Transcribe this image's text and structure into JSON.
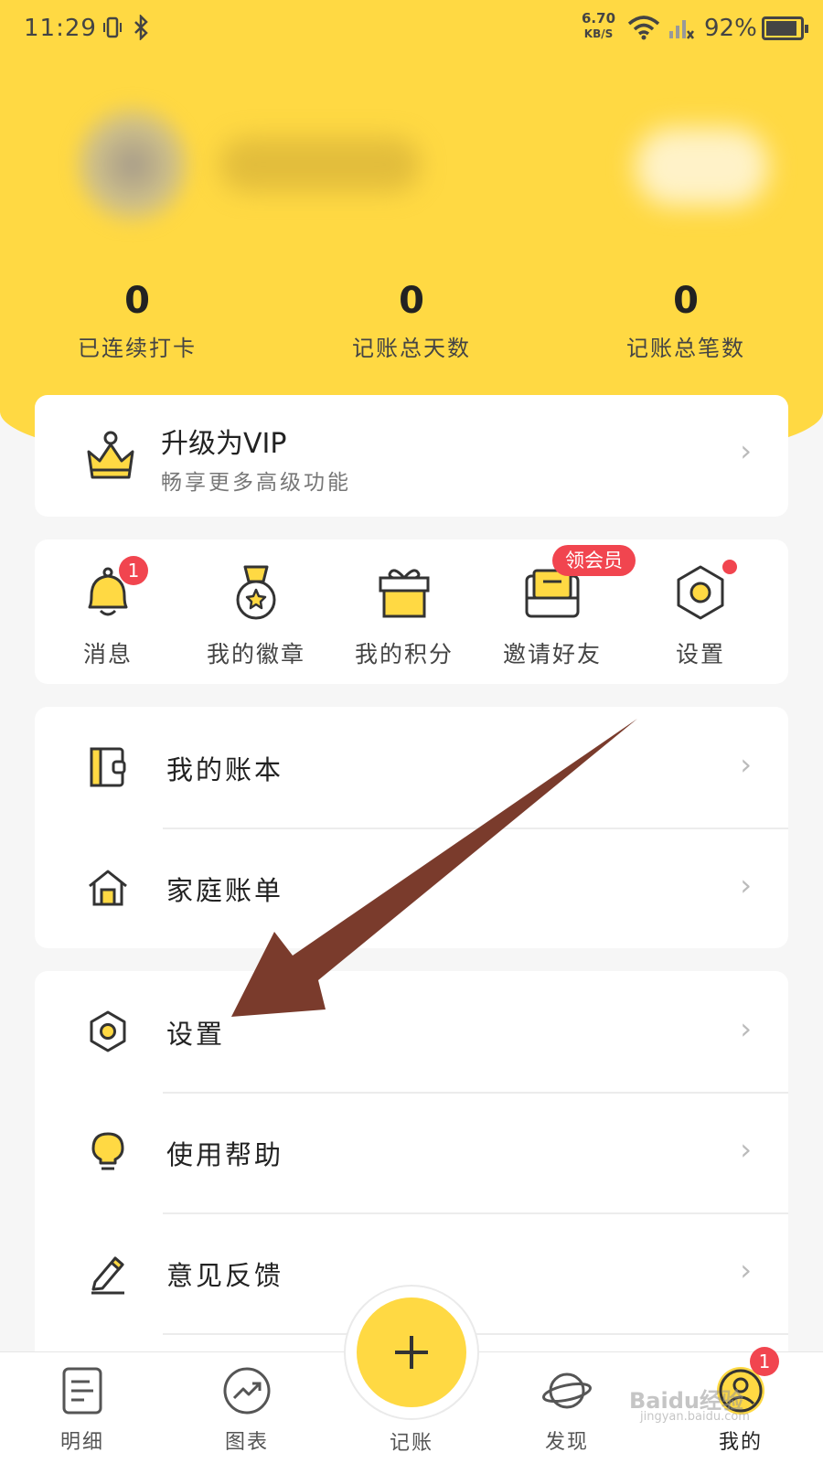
{
  "status_bar": {
    "time": "11:29",
    "net_speed": "6.70",
    "net_unit": "KB/S",
    "battery": "92%"
  },
  "stats": [
    {
      "value": "0",
      "label": "已连续打卡"
    },
    {
      "value": "0",
      "label": "记账总天数"
    },
    {
      "value": "0",
      "label": "记账总笔数"
    }
  ],
  "vip": {
    "title": "升级为VIP",
    "subtitle": "畅享更多高级功能",
    "icon": "crown-icon"
  },
  "shortcuts": [
    {
      "label": "消息",
      "icon": "bell-icon",
      "badge": "1"
    },
    {
      "label": "我的徽章",
      "icon": "medal-icon"
    },
    {
      "label": "我的积分",
      "icon": "gift-icon"
    },
    {
      "label": "邀请好友",
      "icon": "envelope-icon",
      "badge": "领会员"
    },
    {
      "label": "设置",
      "icon": "hexagon-gear-icon"
    }
  ],
  "menu_group_1": [
    {
      "label": "我的账本",
      "icon": "ledger-icon"
    },
    {
      "label": "家庭账单",
      "icon": "house-icon"
    }
  ],
  "menu_group_2": [
    {
      "label": "设置",
      "icon": "hexagon-gear-icon"
    },
    {
      "label": "使用帮助",
      "icon": "lightbulb-icon"
    },
    {
      "label": "意见反馈",
      "icon": "pencil-icon"
    }
  ],
  "tabbar": {
    "tabs": [
      {
        "label": "明细",
        "icon": "document-icon"
      },
      {
        "label": "图表",
        "icon": "chart-icon"
      },
      {
        "label": "记账",
        "icon": "plus-icon"
      },
      {
        "label": "发现",
        "icon": "planet-icon"
      },
      {
        "label": "我的",
        "icon": "user-icon",
        "badge": "1"
      }
    ]
  },
  "watermark": {
    "text": "Baidu经验",
    "sub": "jingyan.baidu.com"
  },
  "colors": {
    "brand_yellow": "#ffd943",
    "badge_red": "#f1454f",
    "arrow_brown": "#7a3b2c"
  }
}
